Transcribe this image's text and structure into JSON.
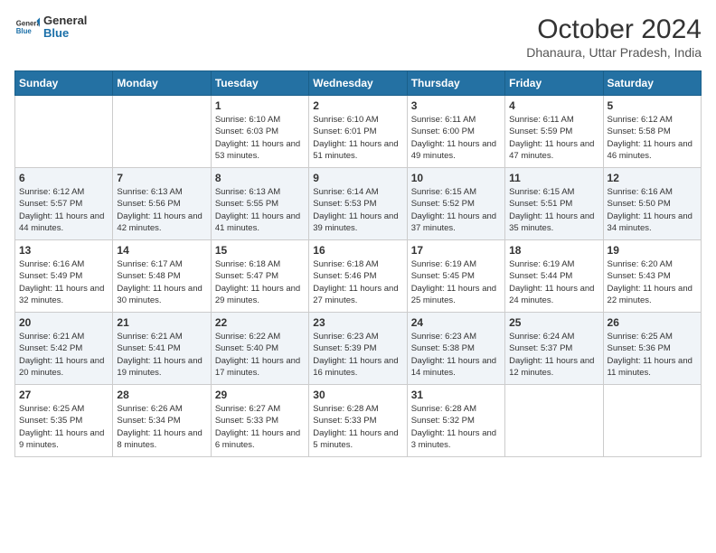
{
  "logo": {
    "line1": "General",
    "line2": "Blue"
  },
  "title": "October 2024",
  "subtitle": "Dhanaura, Uttar Pradesh, India",
  "weekdays": [
    "Sunday",
    "Monday",
    "Tuesday",
    "Wednesday",
    "Thursday",
    "Friday",
    "Saturday"
  ],
  "weeks": [
    [
      {
        "day": "",
        "info": ""
      },
      {
        "day": "",
        "info": ""
      },
      {
        "day": "1",
        "info": "Sunrise: 6:10 AM\nSunset: 6:03 PM\nDaylight: 11 hours and 53 minutes."
      },
      {
        "day": "2",
        "info": "Sunrise: 6:10 AM\nSunset: 6:01 PM\nDaylight: 11 hours and 51 minutes."
      },
      {
        "day": "3",
        "info": "Sunrise: 6:11 AM\nSunset: 6:00 PM\nDaylight: 11 hours and 49 minutes."
      },
      {
        "day": "4",
        "info": "Sunrise: 6:11 AM\nSunset: 5:59 PM\nDaylight: 11 hours and 47 minutes."
      },
      {
        "day": "5",
        "info": "Sunrise: 6:12 AM\nSunset: 5:58 PM\nDaylight: 11 hours and 46 minutes."
      }
    ],
    [
      {
        "day": "6",
        "info": "Sunrise: 6:12 AM\nSunset: 5:57 PM\nDaylight: 11 hours and 44 minutes."
      },
      {
        "day": "7",
        "info": "Sunrise: 6:13 AM\nSunset: 5:56 PM\nDaylight: 11 hours and 42 minutes."
      },
      {
        "day": "8",
        "info": "Sunrise: 6:13 AM\nSunset: 5:55 PM\nDaylight: 11 hours and 41 minutes."
      },
      {
        "day": "9",
        "info": "Sunrise: 6:14 AM\nSunset: 5:53 PM\nDaylight: 11 hours and 39 minutes."
      },
      {
        "day": "10",
        "info": "Sunrise: 6:15 AM\nSunset: 5:52 PM\nDaylight: 11 hours and 37 minutes."
      },
      {
        "day": "11",
        "info": "Sunrise: 6:15 AM\nSunset: 5:51 PM\nDaylight: 11 hours and 35 minutes."
      },
      {
        "day": "12",
        "info": "Sunrise: 6:16 AM\nSunset: 5:50 PM\nDaylight: 11 hours and 34 minutes."
      }
    ],
    [
      {
        "day": "13",
        "info": "Sunrise: 6:16 AM\nSunset: 5:49 PM\nDaylight: 11 hours and 32 minutes."
      },
      {
        "day": "14",
        "info": "Sunrise: 6:17 AM\nSunset: 5:48 PM\nDaylight: 11 hours and 30 minutes."
      },
      {
        "day": "15",
        "info": "Sunrise: 6:18 AM\nSunset: 5:47 PM\nDaylight: 11 hours and 29 minutes."
      },
      {
        "day": "16",
        "info": "Sunrise: 6:18 AM\nSunset: 5:46 PM\nDaylight: 11 hours and 27 minutes."
      },
      {
        "day": "17",
        "info": "Sunrise: 6:19 AM\nSunset: 5:45 PM\nDaylight: 11 hours and 25 minutes."
      },
      {
        "day": "18",
        "info": "Sunrise: 6:19 AM\nSunset: 5:44 PM\nDaylight: 11 hours and 24 minutes."
      },
      {
        "day": "19",
        "info": "Sunrise: 6:20 AM\nSunset: 5:43 PM\nDaylight: 11 hours and 22 minutes."
      }
    ],
    [
      {
        "day": "20",
        "info": "Sunrise: 6:21 AM\nSunset: 5:42 PM\nDaylight: 11 hours and 20 minutes."
      },
      {
        "day": "21",
        "info": "Sunrise: 6:21 AM\nSunset: 5:41 PM\nDaylight: 11 hours and 19 minutes."
      },
      {
        "day": "22",
        "info": "Sunrise: 6:22 AM\nSunset: 5:40 PM\nDaylight: 11 hours and 17 minutes."
      },
      {
        "day": "23",
        "info": "Sunrise: 6:23 AM\nSunset: 5:39 PM\nDaylight: 11 hours and 16 minutes."
      },
      {
        "day": "24",
        "info": "Sunrise: 6:23 AM\nSunset: 5:38 PM\nDaylight: 11 hours and 14 minutes."
      },
      {
        "day": "25",
        "info": "Sunrise: 6:24 AM\nSunset: 5:37 PM\nDaylight: 11 hours and 12 minutes."
      },
      {
        "day": "26",
        "info": "Sunrise: 6:25 AM\nSunset: 5:36 PM\nDaylight: 11 hours and 11 minutes."
      }
    ],
    [
      {
        "day": "27",
        "info": "Sunrise: 6:25 AM\nSunset: 5:35 PM\nDaylight: 11 hours and 9 minutes."
      },
      {
        "day": "28",
        "info": "Sunrise: 6:26 AM\nSunset: 5:34 PM\nDaylight: 11 hours and 8 minutes."
      },
      {
        "day": "29",
        "info": "Sunrise: 6:27 AM\nSunset: 5:33 PM\nDaylight: 11 hours and 6 minutes."
      },
      {
        "day": "30",
        "info": "Sunrise: 6:28 AM\nSunset: 5:33 PM\nDaylight: 11 hours and 5 minutes."
      },
      {
        "day": "31",
        "info": "Sunrise: 6:28 AM\nSunset: 5:32 PM\nDaylight: 11 hours and 3 minutes."
      },
      {
        "day": "",
        "info": ""
      },
      {
        "day": "",
        "info": ""
      }
    ]
  ]
}
